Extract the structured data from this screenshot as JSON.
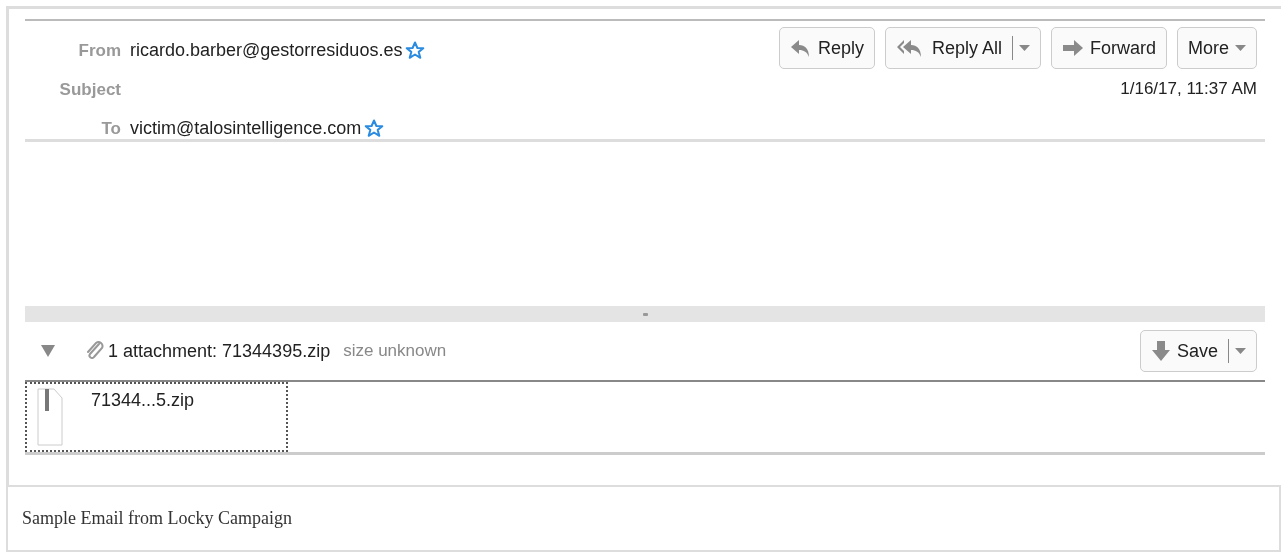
{
  "headers": [
    {
      "label": "From",
      "kind": "address",
      "value": "ricardo.barber@gestorresiduos.es"
    },
    {
      "label": "Subject",
      "kind": "empty"
    },
    {
      "label": "To",
      "kind": "address",
      "value": "victim@talosintelligence.com"
    }
  ],
  "buttons": [
    {
      "label": "Reply",
      "kind": "plain"
    },
    {
      "label": "Reply All",
      "kind": "split"
    },
    {
      "label": "Forward",
      "kind": "plain"
    },
    {
      "label": "More",
      "kind": "caret"
    }
  ],
  "date": "1/16/17, 11:37 AM",
  "attachments": {
    "expanded": true,
    "summary": "1 attachment: 71344395.zip",
    "size": "size unknown",
    "save_button": "Save",
    "files": [
      {
        "name": "71344...5.zip"
      }
    ]
  },
  "caption": "Sample Email from Locky Campaign"
}
